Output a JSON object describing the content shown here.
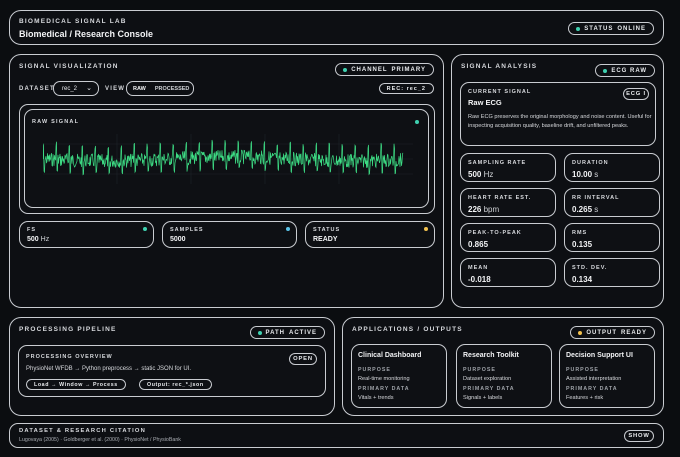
{
  "header": {
    "lab": "Biomedical Signal Lab",
    "title": "Biomedical / Research Console",
    "status_label": "Status",
    "status_value": "Online"
  },
  "viz": {
    "title": "Signal Visualization",
    "channel_label": "Channel",
    "channel_value": "Primary",
    "dataset_label": "Dataset",
    "dataset_value": "rec_2",
    "view_label": "View",
    "view_raw": "Raw",
    "view_processed": "Processed",
    "rec_badge": "REC: rec_2",
    "raw_signal_label": "Raw Signal",
    "fs_label": "FS",
    "fs_value": "500",
    "fs_unit": "Hz",
    "samples_label": "Samples",
    "samples_value": "5000",
    "status_label": "Status",
    "status_value": "READY"
  },
  "analysis": {
    "title": "Signal Analysis",
    "badge": "ECG Raw",
    "current_label": "Current Signal",
    "current_name": "Raw ECG",
    "ecg_button": "ECG I",
    "description": "Raw ECG preserves the original morphology and noise content. Useful for inspecting acquisition quality, baseline drift, and unfiltered peaks.",
    "metrics": [
      {
        "label": "Sampling Rate",
        "value": "500",
        "unit": "Hz"
      },
      {
        "label": "Duration",
        "value": "10.00",
        "unit": "s"
      },
      {
        "label": "Heart Rate Est.",
        "value": "226",
        "unit": "bpm"
      },
      {
        "label": "RR Interval",
        "value": "0.265",
        "unit": "s"
      },
      {
        "label": "Peak-to-Peak",
        "value": "0.865",
        "unit": ""
      },
      {
        "label": "RMS",
        "value": "0.135",
        "unit": ""
      },
      {
        "label": "Mean",
        "value": "-0.018",
        "unit": ""
      },
      {
        "label": "Std. Dev.",
        "value": "0.134",
        "unit": ""
      }
    ]
  },
  "pipeline": {
    "title": "Processing Pipeline",
    "path_label": "Path",
    "path_value": "Active",
    "overview_label": "Processing Overview",
    "open_button": "Open",
    "flow_text": "PhysioNet WFDB → Python preprocess → static JSON for UI.",
    "chip1": "Load → Window → Process",
    "chip2": "Output: rec_*.json"
  },
  "apps": {
    "title": "Applications / Outputs",
    "output_label": "Output",
    "output_value": "Ready",
    "purpose_label": "Purpose",
    "data_label": "Primary Data",
    "cards": [
      {
        "name": "Clinical Dashboard",
        "purpose": "Real-time monitoring",
        "data": "Vitals + trends"
      },
      {
        "name": "Research Toolkit",
        "purpose": "Dataset exploration",
        "data": "Signals + labels"
      },
      {
        "name": "Decision Support UI",
        "purpose": "Assisted interpretation",
        "data": "Features + risk"
      }
    ]
  },
  "citation": {
    "title": "Dataset & Research Citation",
    "text": "Lugovaya (2005) · Goldberger et al. (2000) · PhysioNet / PhysioBank",
    "show_button": "Show"
  },
  "colors": {
    "signal": "#3ddc84",
    "dot_teal": "#3fd1b0",
    "dot_blue": "#59c3e8",
    "dot_yellow": "#f2c14e"
  }
}
